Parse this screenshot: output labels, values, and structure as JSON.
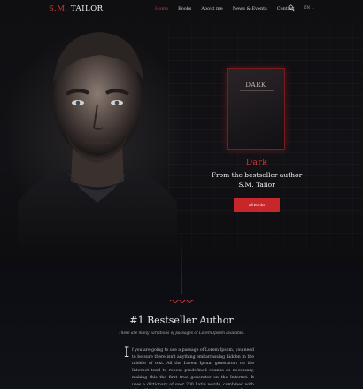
{
  "nav": {
    "logo_sm": "S.M.",
    "logo_tailor": "TAILOR",
    "items": [
      {
        "label": "Home",
        "active": true
      },
      {
        "label": "Books",
        "active": false
      },
      {
        "label": "About me",
        "active": false
      },
      {
        "label": "News & Events",
        "active": false
      },
      {
        "label": "Contact",
        "active": false
      }
    ],
    "search_icon": "search-icon",
    "lang": "EN  ⌄"
  },
  "hero": {
    "book_cover_title": "DARK",
    "book_title": "Dark",
    "line1": "From the bestseller author",
    "line2": "S.M. Tailor",
    "button": "All Books"
  },
  "section": {
    "title": "#1 Bestseller Author",
    "subtitle": "There are many variations of passages of Lorem Ipsum available.",
    "dropcap": "I",
    "body": "f you are going to use a passage of Lorem Ipsum, you need to be sure there isn't anything embarrassing hidden in the middle of text. All the Lorem Ipsum generators on the Internet tend to repeat predefined chunks as necessary, making this the first true generator on the Internet. It uses a dictionary of over 200 Latin words, combined with a handful of model sentence structures, to generate Lorem Ipsum which looks"
  },
  "colors": {
    "accent": "#d03a35",
    "button": "#c7262a",
    "background": "#0b0b0d"
  }
}
